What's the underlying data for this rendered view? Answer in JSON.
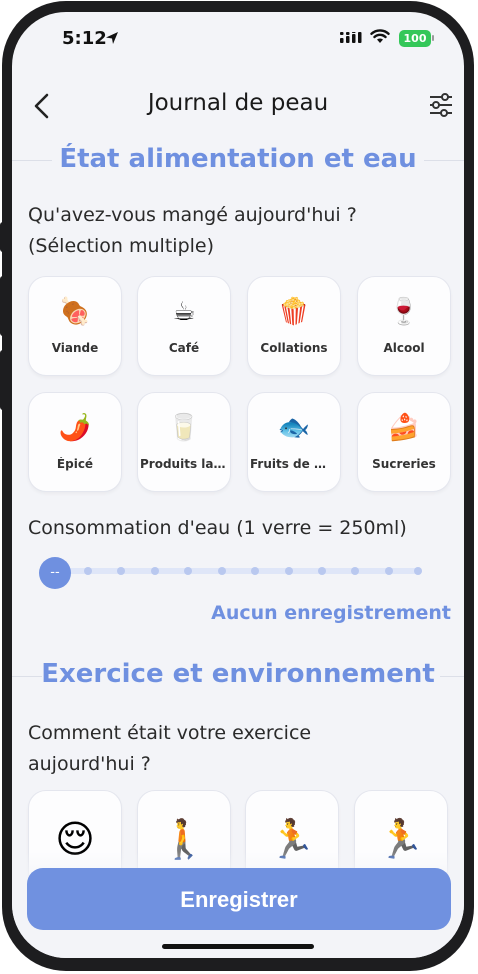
{
  "status_bar": {
    "time": "5:12",
    "battery": "100"
  },
  "header": {
    "title": "Journal de peau"
  },
  "food_section": {
    "title": "État alimentation et eau",
    "question": "Qu'avez-vous mangé aujourd'hui ?",
    "question_hint": "(Sélection multiple)",
    "items": [
      {
        "label": "Viande",
        "emoji": "🍖"
      },
      {
        "label": "Café",
        "emoji": "☕"
      },
      {
        "label": "Collations",
        "emoji": "🍿"
      },
      {
        "label": "Alcool",
        "emoji": "🍷"
      },
      {
        "label": "Épicé",
        "emoji": "🌶️"
      },
      {
        "label": "Produits lai···",
        "emoji": "🥛"
      },
      {
        "label": "Fruits de mer",
        "emoji": "🐟"
      },
      {
        "label": "Sucreries",
        "emoji": "🍰"
      }
    ]
  },
  "water": {
    "label": "Consommation d'eau  (1 verre = 250ml)",
    "thumb_text": "--",
    "glasses_selected": 0,
    "status": "Aucun enregistrement"
  },
  "exercise_section": {
    "title": "Exercice et environnement",
    "question_line1": "Comment était votre exercice",
    "question_line2": "aujourd'hui ?",
    "items": [
      {
        "emoji": "😌"
      },
      {
        "emoji": "🚶"
      },
      {
        "emoji": "🏃"
      },
      {
        "emoji": "🏃"
      }
    ]
  },
  "save_label": "Enregistrer",
  "colors": {
    "accent": "#6f90e0",
    "background": "#f3f4f8",
    "battery": "#34c759"
  }
}
